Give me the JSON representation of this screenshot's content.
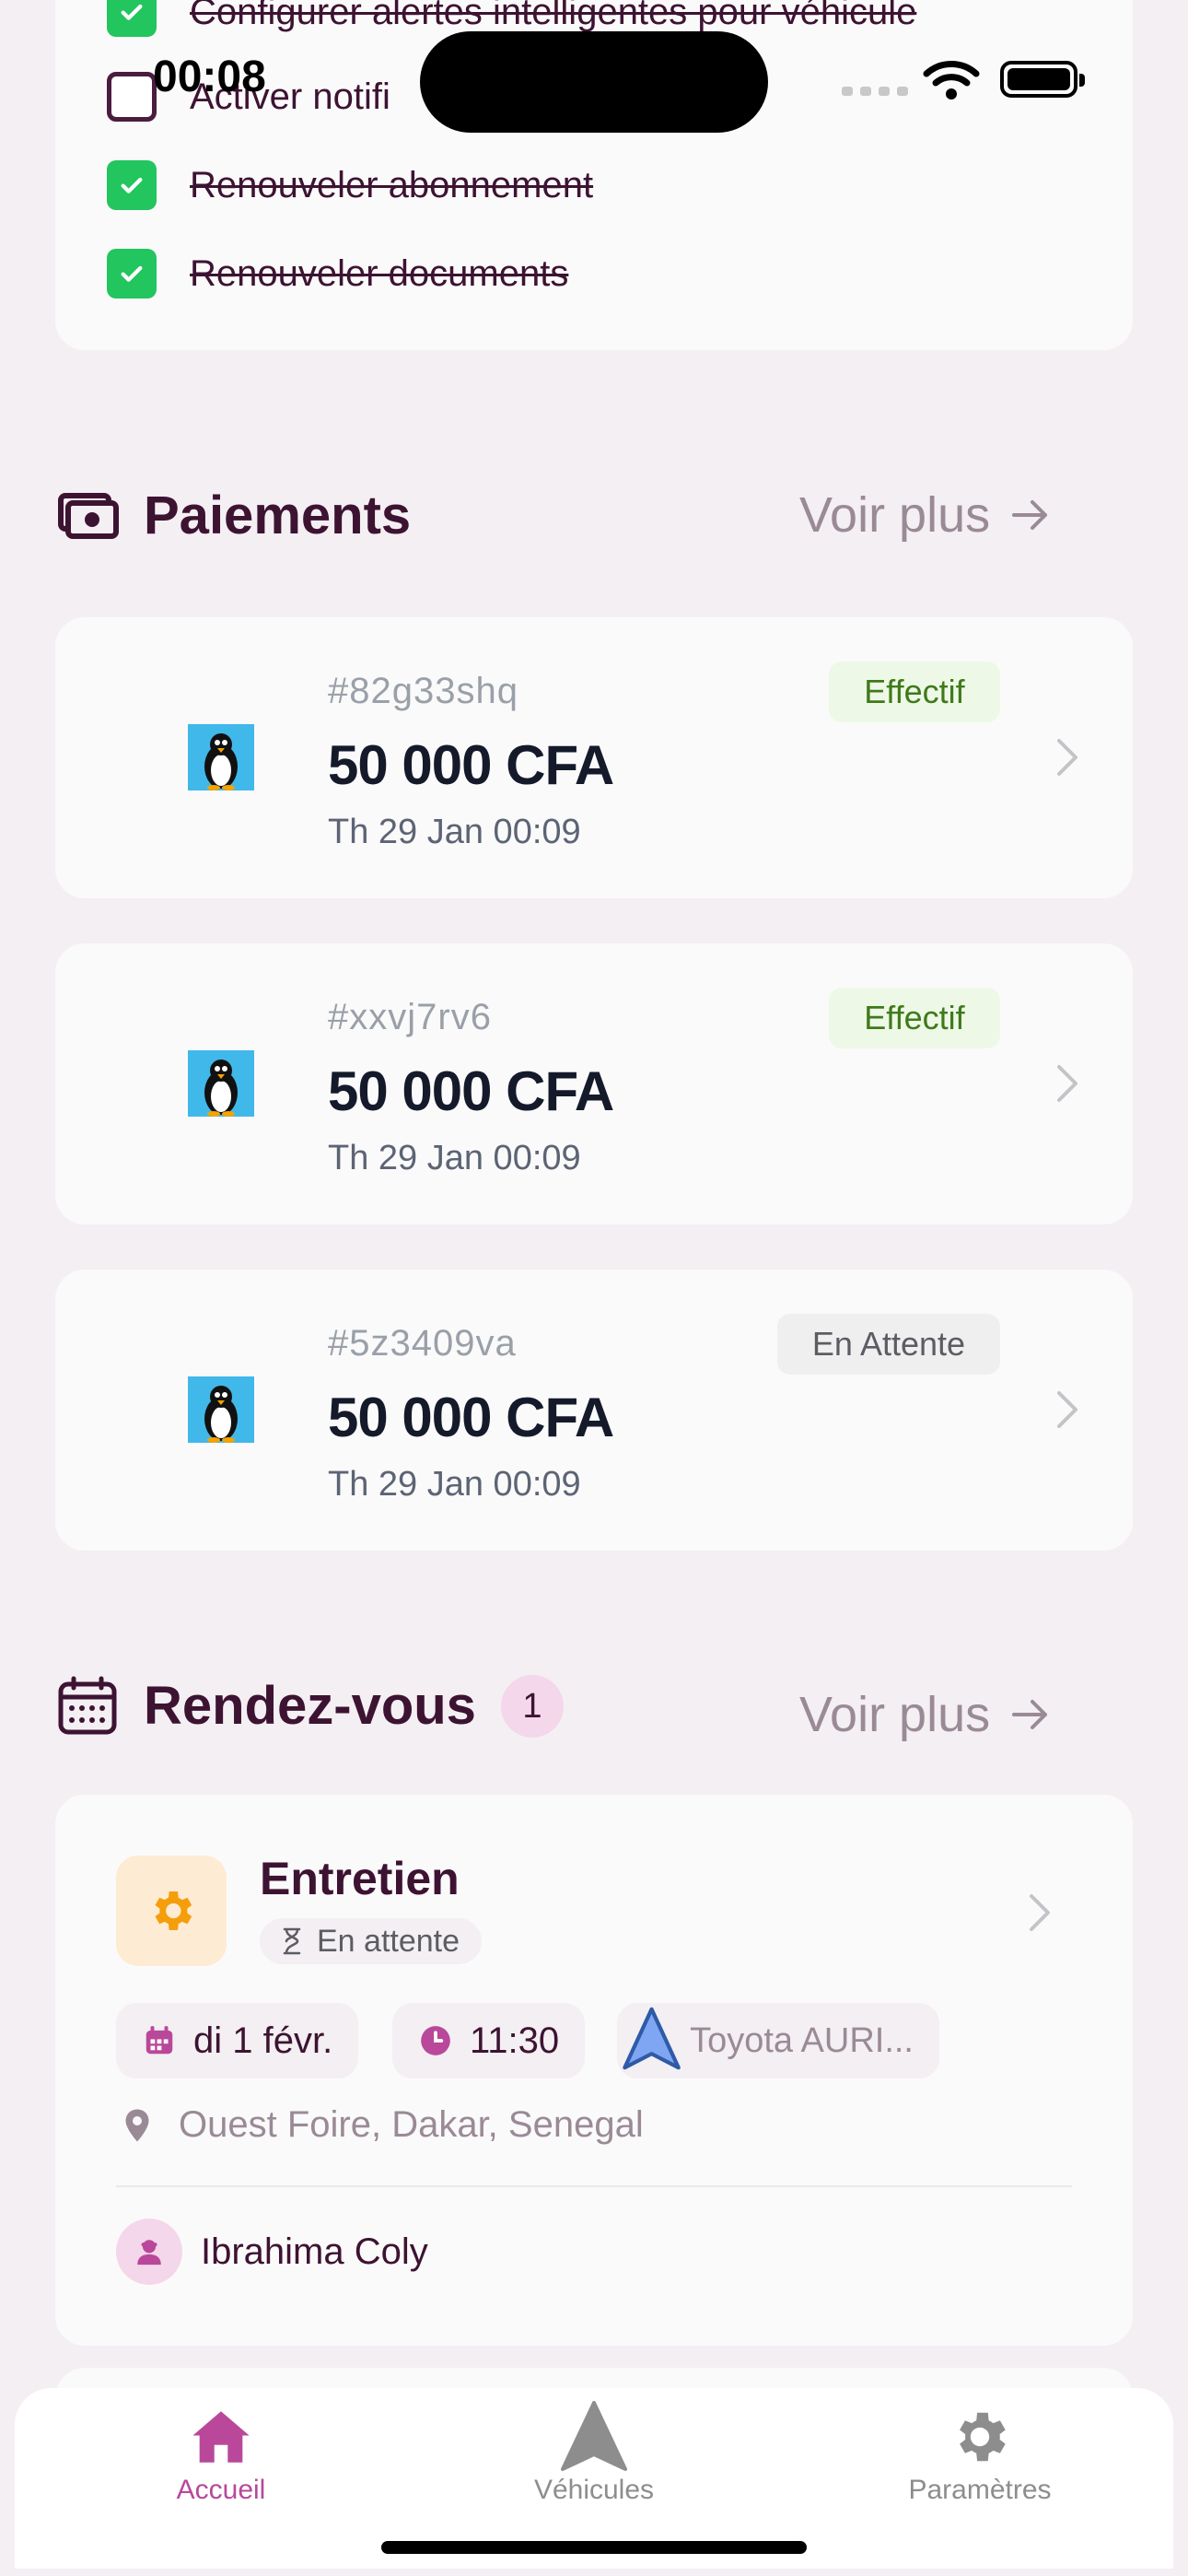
{
  "status_bar": {
    "time": "00:08"
  },
  "tasks": [
    {
      "label": "Configurer alertes intelligentes pour véhicule",
      "checked": true
    },
    {
      "label": "Activer notifi",
      "checked": false
    },
    {
      "label": "Renouveler abonnement",
      "checked": true
    },
    {
      "label": "Renouveler documents",
      "checked": true
    }
  ],
  "payments": {
    "title": "Paiements",
    "more_label": "Voir plus",
    "items": [
      {
        "id": "#82g33shq",
        "amount": "50 000 CFA",
        "date": "Th 29 Jan 00:09",
        "status": "Effectif"
      },
      {
        "id": "#xxvj7rv6",
        "amount": "50 000 CFA",
        "date": "Th 29 Jan 00:09",
        "status": "Effectif"
      },
      {
        "id": "#5z3409va",
        "amount": "50 000 CFA",
        "date": "Th 29 Jan 00:09",
        "status": "En Attente"
      }
    ]
  },
  "appointments": {
    "title": "Rendez-vous",
    "count": "1",
    "more_label": "Voir plus",
    "item": {
      "type": "Entretien",
      "status": "En attente",
      "date": "di 1 févr.",
      "time": "11:30",
      "vehicle": "Toyota AURI...",
      "location": "Ouest Foire, Dakar, Senegal",
      "mechanic": "Ibrahima Coly"
    }
  },
  "nav": {
    "items": [
      {
        "label": "Accueil",
        "icon": "home-icon",
        "active": true
      },
      {
        "label": "Véhicules",
        "icon": "vehicle-icon",
        "active": false
      },
      {
        "label": "Paramètres",
        "icon": "gear-icon",
        "active": false
      }
    ]
  },
  "colors": {
    "accent": "#b9489a",
    "success_badge_bg": "#eef8e6",
    "success_badge_text": "#3f7a1a",
    "pending_badge_bg": "#efefef",
    "checkbox_green": "#22c55e"
  }
}
